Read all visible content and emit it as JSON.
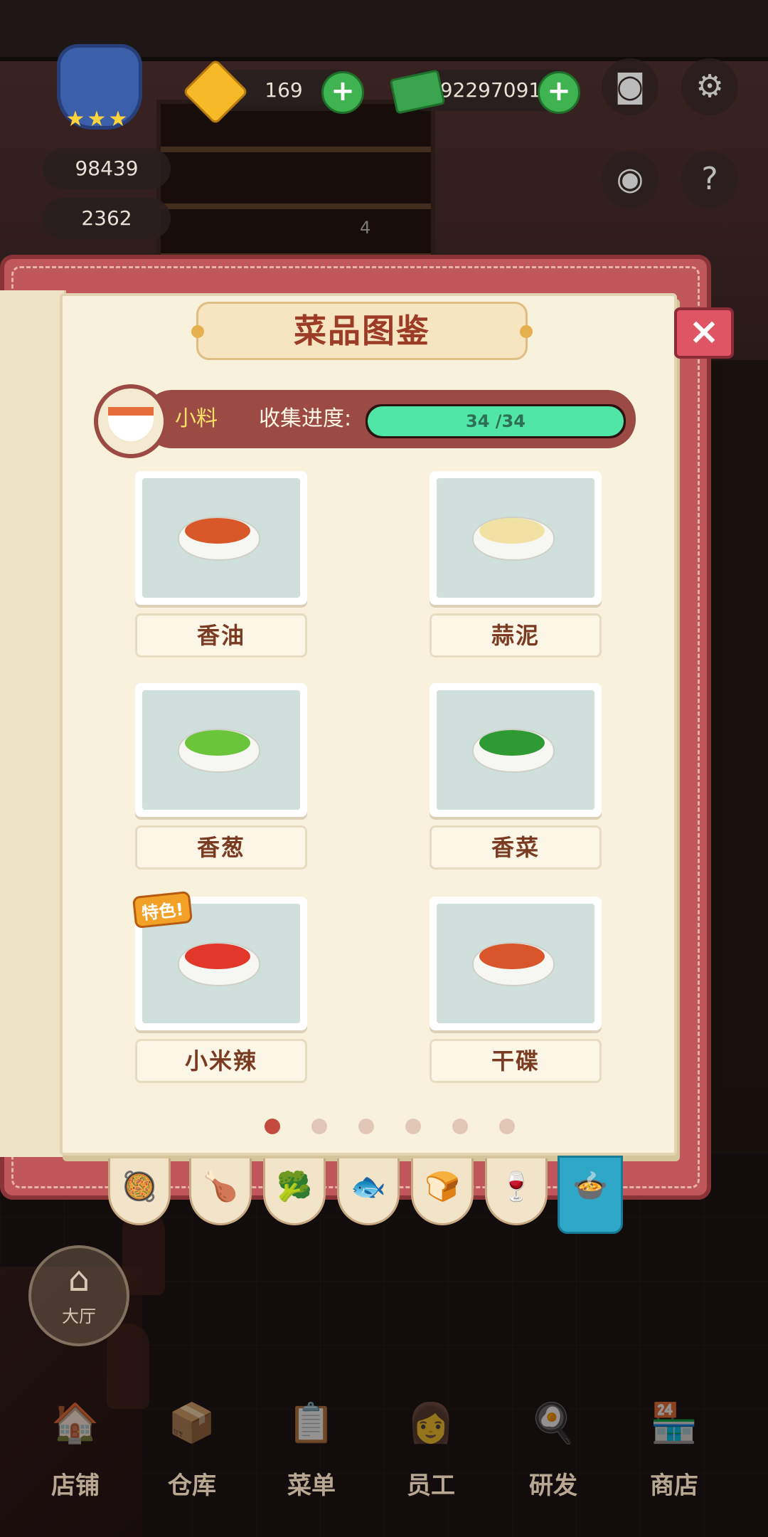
{
  "hud": {
    "gems": "169",
    "cash": "92297091",
    "gold": "98439",
    "staff_count": "2362",
    "stars": 3,
    "shelf_badge": "4",
    "icons": [
      "camera-icon",
      "gear-icon",
      "eye-icon",
      "help-book-icon"
    ]
  },
  "book": {
    "title": "菜品图鉴",
    "close_icon": "×",
    "category": "小料",
    "progress_label": "收集进度:",
    "progress_text": "34 /34",
    "progress_value": 1.0,
    "items": [
      {
        "name": "香油",
        "tag": "",
        "food_color": "#d9582a"
      },
      {
        "name": "蒜泥",
        "tag": "",
        "food_color": "#f1e2a4"
      },
      {
        "name": "香葱",
        "tag": "",
        "food_color": "#6bc53a"
      },
      {
        "name": "香菜",
        "tag": "",
        "food_color": "#2e9a34"
      },
      {
        "name": "小米辣",
        "tag": "特色!",
        "food_color": "#e2382b"
      },
      {
        "name": "干碟",
        "tag": "",
        "food_color": "#d9552c"
      }
    ],
    "pages": {
      "total": 6,
      "current": 1
    }
  },
  "tabs": [
    {
      "icon": "wok-icon",
      "glyph": "🥘",
      "active": false
    },
    {
      "icon": "drumstick-icon",
      "glyph": "🍗",
      "active": false
    },
    {
      "icon": "broccoli-icon",
      "glyph": "🥦",
      "active": false
    },
    {
      "icon": "fish-icon",
      "glyph": "🐟",
      "active": false
    },
    {
      "icon": "bread-icon",
      "glyph": "🍞",
      "active": false
    },
    {
      "icon": "wine-glass-icon",
      "glyph": "🍷",
      "active": false
    },
    {
      "icon": "sauce-bowl-icon",
      "glyph": "🍲",
      "active": true
    }
  ],
  "lobby": {
    "label": "大厅",
    "icon": "house-icon"
  },
  "nav": [
    {
      "label": "店铺",
      "icon": "shop-icon",
      "glyph": "🏠"
    },
    {
      "label": "仓库",
      "icon": "warehouse-icon",
      "glyph": "📦"
    },
    {
      "label": "菜单",
      "icon": "menu-clipboard-icon",
      "glyph": "📋"
    },
    {
      "label": "员工",
      "icon": "staff-icon",
      "glyph": "👩"
    },
    {
      "label": "研发",
      "icon": "research-wok-icon",
      "glyph": "🍳"
    },
    {
      "label": "商店",
      "icon": "store-icon",
      "glyph": "🏪"
    }
  ]
}
